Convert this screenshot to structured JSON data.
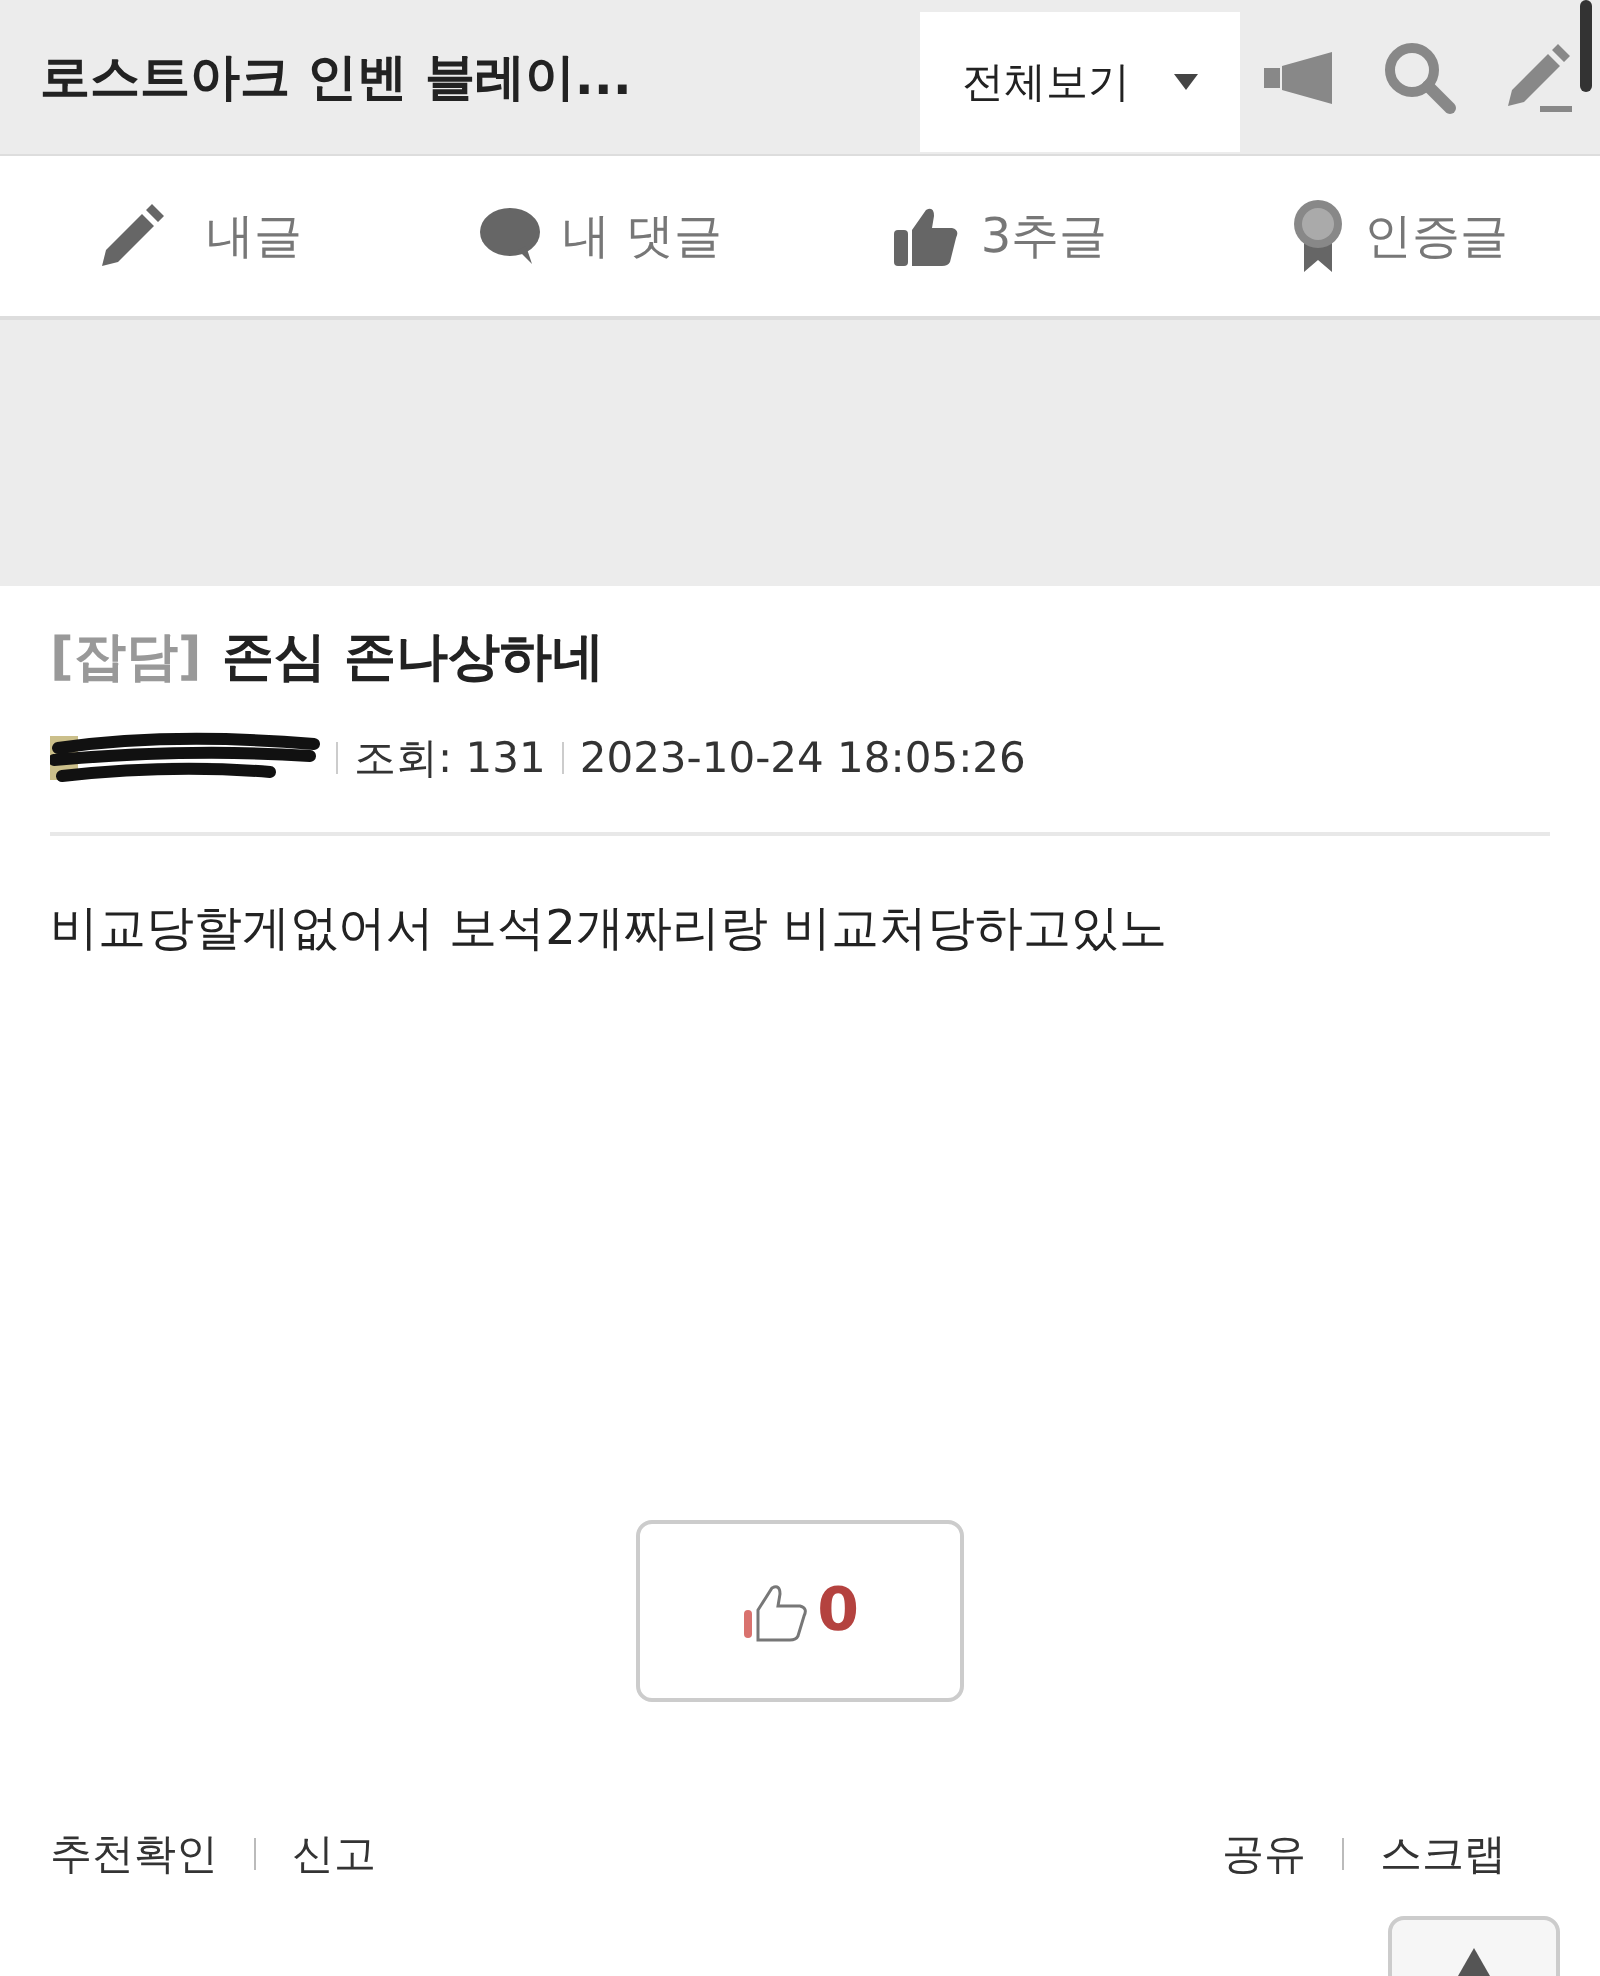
{
  "header": {
    "title": "로스트아크 인벤 블레이...",
    "filter": "전체보기"
  },
  "nav": [
    {
      "kind": "mine",
      "label": "내글"
    },
    {
      "kind": "comments",
      "label": "내 댓글"
    },
    {
      "kind": "likes",
      "label": "3추글"
    },
    {
      "kind": "certified",
      "label": "인증글"
    }
  ],
  "post": {
    "category": "[잡담]",
    "title": "존심 존나상하네",
    "views": "조회: 131",
    "date": "2023-10-24 18:05:26",
    "body": "비교당할게없어서 보석2개짜리랑 비교처당하고있노",
    "likes": "0"
  },
  "footer": {
    "left": [
      "추천확인",
      "신고"
    ],
    "right": [
      "공유",
      "스크랩"
    ]
  }
}
